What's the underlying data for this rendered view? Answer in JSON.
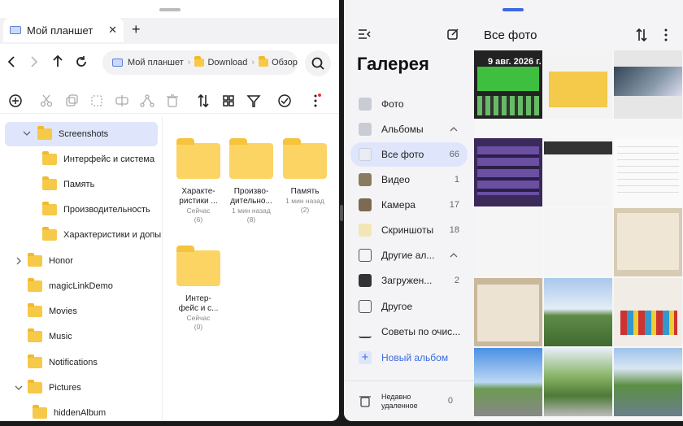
{
  "files_app": {
    "tab_title": "Мой планшет",
    "breadcrumb": [
      "Мой планшет",
      "Download",
      "Обзор"
    ],
    "tree": [
      {
        "label": "Screenshots",
        "level": 1,
        "expanded": true,
        "selected": true
      },
      {
        "label": "Интерфейс и система",
        "level": 2
      },
      {
        "label": "Память",
        "level": 2
      },
      {
        "label": "Производительность",
        "level": 2
      },
      {
        "label": "Характеристики и допы",
        "level": 2
      },
      {
        "label": "Honor",
        "level": 1,
        "collapsed": true
      },
      {
        "label": "magicLinkDemo",
        "level": 1
      },
      {
        "label": "Movies",
        "level": 1
      },
      {
        "label": "Music",
        "level": 1
      },
      {
        "label": "Notifications",
        "level": 1
      },
      {
        "label": "Pictures",
        "level": 1,
        "expanded": true
      },
      {
        "label": "hiddenAlbum",
        "level": 2
      }
    ],
    "folders": [
      {
        "name_lines": [
          "Характе-",
          "ристики ..."
        ],
        "time": "Сейчас",
        "count": "(6)"
      },
      {
        "name_lines": [
          "Произво-",
          "дительно..."
        ],
        "time": "1 мин назад",
        "count": "(8)"
      },
      {
        "name_lines": [
          "Память"
        ],
        "time": "1 мин назад",
        "count": "(2)"
      },
      {
        "name_lines": [
          "Интер-",
          "фейс и с..."
        ],
        "time": "Сейчас",
        "count": "(0)"
      }
    ]
  },
  "gallery_app": {
    "title": "Галерея",
    "header_title": "Все фото",
    "date_label": "9 авг. 2026 г.",
    "nav": [
      {
        "label": "Фото",
        "count": ""
      },
      {
        "label": "Альбомы",
        "count": ""
      },
      {
        "label": "Все фото",
        "count": "66"
      },
      {
        "label": "Видео",
        "count": "1"
      },
      {
        "label": "Камера",
        "count": "17"
      },
      {
        "label": "Скриншоты",
        "count": "18"
      },
      {
        "label": "Другие ал...",
        "count": ""
      },
      {
        "label": "Загружен...",
        "count": "2"
      },
      {
        "label": "Другое",
        "count": ""
      },
      {
        "label": "Советы по очис...",
        "count": ""
      },
      {
        "label": "Новый альбом",
        "count": ""
      }
    ],
    "recently_deleted": [
      "Недавно",
      "удаленное"
    ],
    "recently_deleted_count": "0"
  },
  "colors": {
    "accent": "#3a6ae0",
    "folder": "#f7c948",
    "selected": "#dfe6fb"
  }
}
